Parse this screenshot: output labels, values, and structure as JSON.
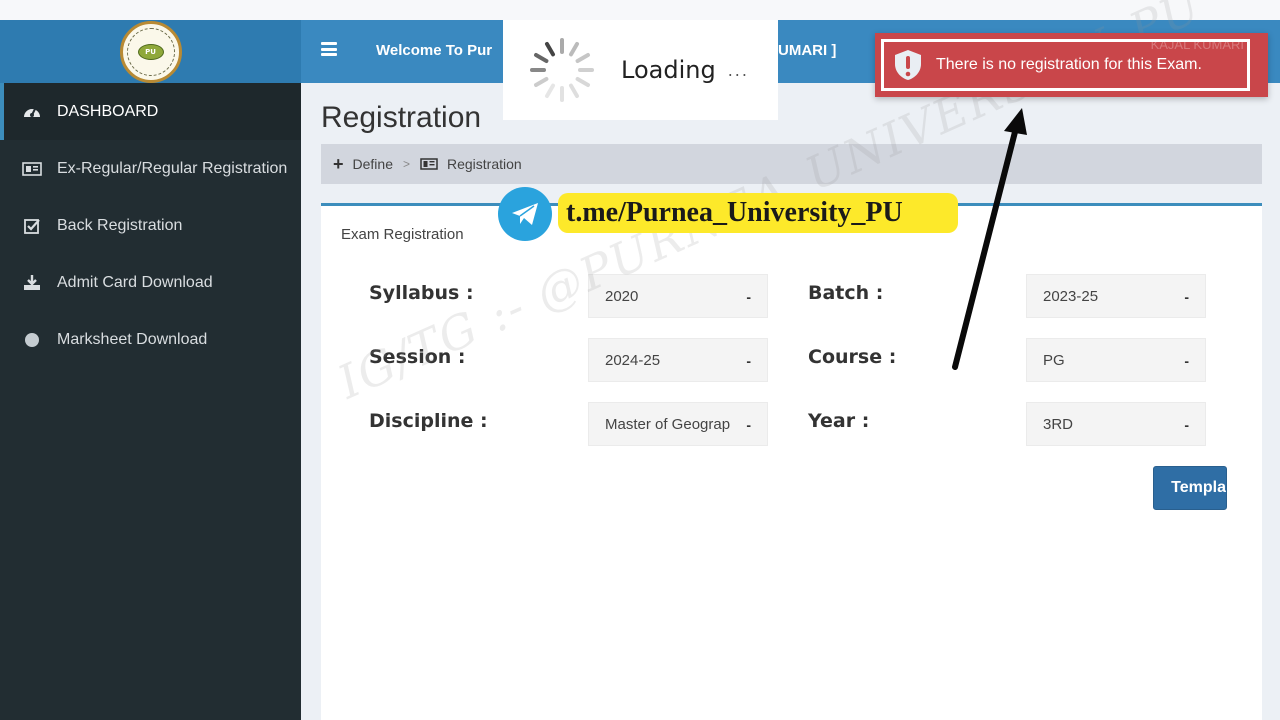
{
  "header": {
    "welcome_text": "Welcome To Pur",
    "user_tail": "UMARI ]",
    "menu_icon": "hamburger-icon",
    "logo": "university-seal-logo"
  },
  "sidebar": {
    "items": [
      {
        "label": "DASHBOARD",
        "icon": "dashboard-gauge-icon",
        "active": true
      },
      {
        "label": "Ex-Regular/Regular Registration",
        "icon": "id-card-icon",
        "active": false
      },
      {
        "label": "Back Registration",
        "icon": "check-square-icon",
        "active": false
      },
      {
        "label": "Admit Card Download",
        "icon": "download-icon",
        "active": false
      },
      {
        "label": "Marksheet Download",
        "icon": "circle-icon",
        "active": false
      }
    ]
  },
  "page": {
    "title": "Registration",
    "breadcrumb": [
      {
        "label": "Define",
        "icon": "plus-icon"
      },
      {
        "label": "Registration",
        "icon": "id-card-icon"
      }
    ],
    "breadcrumb_separator": ">"
  },
  "form": {
    "box_title": "Exam Registration",
    "fields": {
      "syllabus": {
        "label": "Syllabus :",
        "value": "2020"
      },
      "session": {
        "label": "Session :",
        "value": "2024-25"
      },
      "discipline": {
        "label": "Discipline :",
        "value": "Master of Geograp"
      },
      "batch": {
        "label": "Batch :",
        "value": "2023-25"
      },
      "course": {
        "label": "Course :",
        "value": "PG"
      },
      "year": {
        "label": "Year :",
        "value": "3RD"
      }
    },
    "caret": "-",
    "template_button": "Templa"
  },
  "loading": {
    "text": "Loading",
    "dots": "..."
  },
  "alert": {
    "message": "There is no registration for this Exam.",
    "ghost_text": "KAJAL KUMARI",
    "icon": "shield-exclamation-icon",
    "color": "#c9464a"
  },
  "promo": {
    "telegram_link": "t.me/Purnea_University_PU",
    "watermark": "IG/TG :- @PURNEA_UNIVERSITY_PU"
  },
  "colors": {
    "header_blue": "#3a89c0",
    "logo_bg": "#2e7bb0",
    "sidebar_dark": "#222d32",
    "accent": "#3c8dbc",
    "button_blue": "#2f6ea5",
    "promo_yellow": "#fde92a",
    "telegram_blue": "#2aa3dd"
  }
}
